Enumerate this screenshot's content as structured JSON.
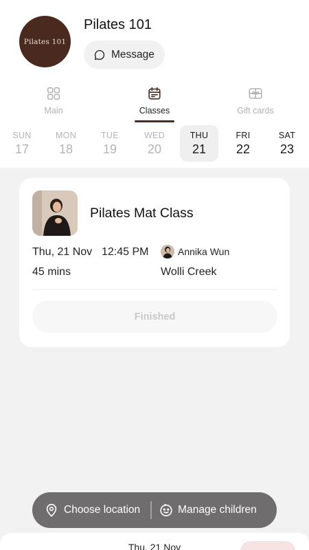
{
  "studio": {
    "name": "Pilates 101",
    "logo_text": "Pilates 101",
    "message_label": "Message"
  },
  "tabs": [
    {
      "label": "Main",
      "icon": "grid-icon",
      "active": false
    },
    {
      "label": "Classes",
      "icon": "calendar-icon",
      "active": true
    },
    {
      "label": "Gift cards",
      "icon": "gift-card-icon",
      "active": false
    }
  ],
  "days": [
    {
      "name": "SUN",
      "date": "17",
      "state": "past"
    },
    {
      "name": "MON",
      "date": "18",
      "state": "past"
    },
    {
      "name": "TUE",
      "date": "19",
      "state": "past"
    },
    {
      "name": "WED",
      "date": "20",
      "state": "past"
    },
    {
      "name": "THU",
      "date": "21",
      "state": "selected"
    },
    {
      "name": "FRI",
      "date": "22",
      "state": "future"
    },
    {
      "name": "SAT",
      "date": "23",
      "state": "future"
    }
  ],
  "class_card": {
    "title": "Pilates Mat Class",
    "date": "Thu, 21 Nov",
    "time": "12:45 PM",
    "instructor": "Annika Wun",
    "duration": "45 mins",
    "location": "Wolli Creek",
    "status_button": "Finished"
  },
  "floating_bar": {
    "location_label": "Choose location",
    "children_label": "Manage children"
  },
  "bottom_sheet": {
    "date": "Thu, 21 Nov"
  },
  "colors": {
    "brand": "#4a2a1f",
    "floating_bar": "#6f6d6d",
    "background": "#f2f2f2"
  }
}
